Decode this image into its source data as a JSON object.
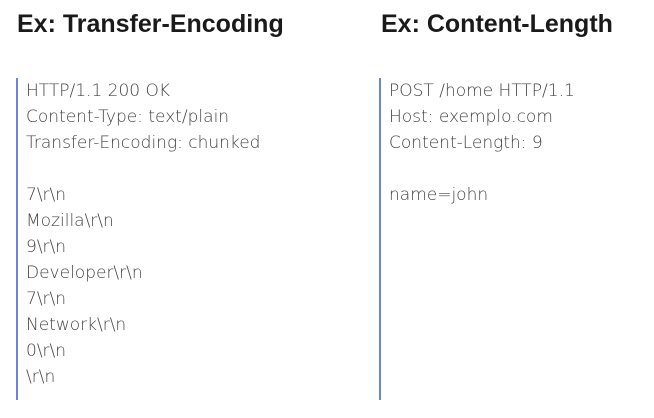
{
  "left": {
    "title": "Ex: Transfer-Encoding",
    "lines": [
      "HTTP/1.1 200 OK",
      "Content-Type: text/plain",
      "Transfer-Encoding: chunked",
      "",
      "7\\r\\n",
      "Mozilla\\r\\n",
      "9\\r\\n",
      "Developer\\r\\n",
      "7\\r\\n",
      "Network\\r\\n",
      "0\\r\\n",
      "\\r\\n"
    ]
  },
  "right": {
    "title": "Ex: Content-Length",
    "lines": [
      "POST /home HTTP/1.1",
      "Host: exemplo.com",
      "Content-Length: 9",
      "",
      "name=john"
    ]
  },
  "accent": "#6b84e0"
}
